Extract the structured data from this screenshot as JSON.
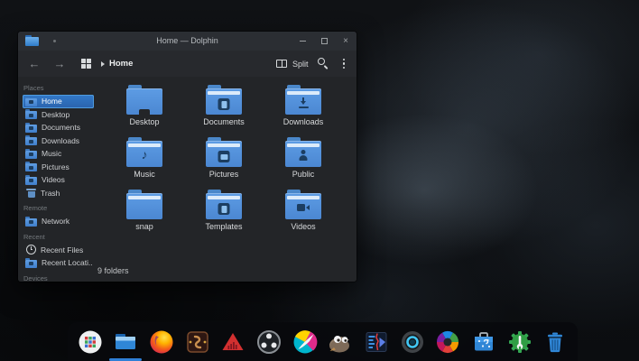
{
  "window": {
    "title": "Home — Dolphin",
    "toolbar": {
      "breadcrumb": "Home",
      "split_label": "Split"
    },
    "sidebar": {
      "sections": [
        {
          "header": "Places",
          "items": [
            {
              "label": "Home",
              "selected": true
            },
            {
              "label": "Desktop"
            },
            {
              "label": "Documents"
            },
            {
              "label": "Downloads"
            },
            {
              "label": "Music"
            },
            {
              "label": "Pictures"
            },
            {
              "label": "Videos"
            },
            {
              "label": "Trash"
            }
          ]
        },
        {
          "header": "Remote",
          "items": [
            {
              "label": "Network"
            }
          ]
        },
        {
          "header": "Recent",
          "items": [
            {
              "label": "Recent Files"
            },
            {
              "label": "Recent Locati..."
            }
          ]
        },
        {
          "header": "Devices",
          "items": []
        }
      ]
    },
    "files": [
      {
        "label": "Desktop",
        "emblem": "desktop"
      },
      {
        "label": "Documents",
        "emblem": "document"
      },
      {
        "label": "Downloads",
        "emblem": "download"
      },
      {
        "label": "Music",
        "emblem": "music"
      },
      {
        "label": "Pictures",
        "emblem": "image"
      },
      {
        "label": "Public",
        "emblem": "user"
      },
      {
        "label": "snap",
        "emblem": "none"
      },
      {
        "label": "Templates",
        "emblem": "document"
      },
      {
        "label": "Videos",
        "emblem": "video"
      }
    ],
    "statusbar": {
      "text": "9 folders"
    }
  },
  "dock": {
    "apps": [
      {
        "name": "app-launcher"
      },
      {
        "name": "file-manager",
        "active": true
      },
      {
        "name": "firefox"
      },
      {
        "name": "ardour"
      },
      {
        "name": "audio-triangle-app"
      },
      {
        "name": "obs-studio"
      },
      {
        "name": "krita"
      },
      {
        "name": "gimp"
      },
      {
        "name": "video-editor"
      },
      {
        "name": "camera-lens-app"
      },
      {
        "name": "photo-aperture-app"
      },
      {
        "name": "discover-store"
      },
      {
        "name": "system-settings"
      },
      {
        "name": "trash"
      }
    ]
  },
  "icons": {
    "back_glyph": "←",
    "forward_glyph": "→",
    "close_glyph": "×",
    "music_glyph": "♪"
  },
  "colors": {
    "accent": "#3daee9",
    "selection": "#2c6fbd",
    "folder_blue": "#5294e2",
    "window_bg": "#26292d",
    "titlebar_bg": "#2b2e33",
    "dock_bg": "#080a0d",
    "run_indicator": "#2f7fd6"
  }
}
